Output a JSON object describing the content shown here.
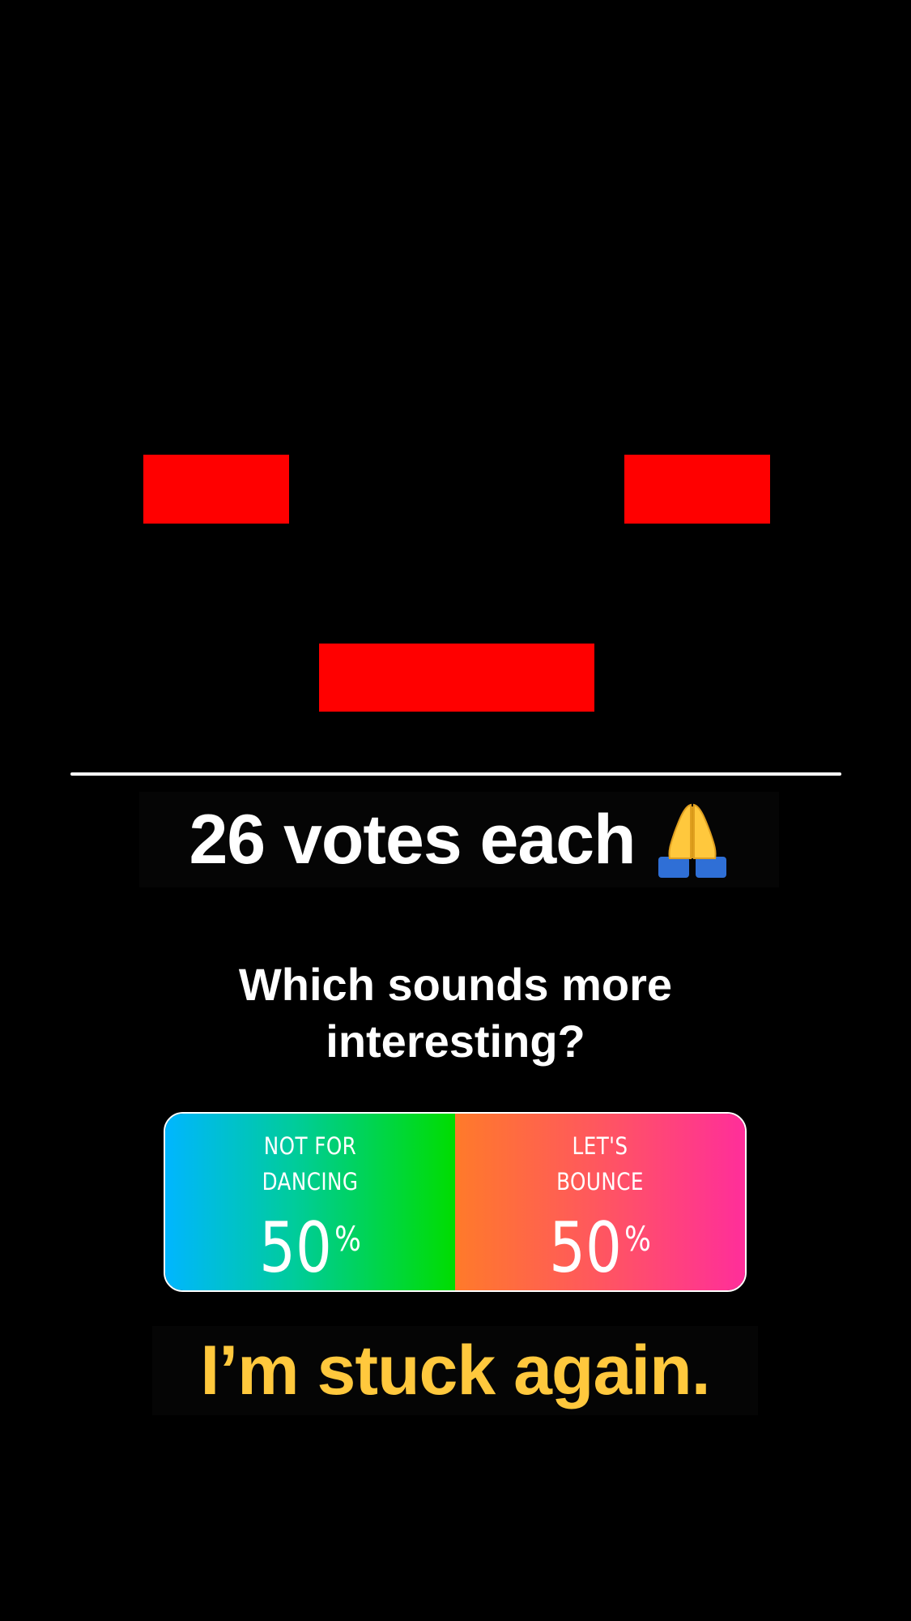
{
  "colors": {
    "background": "#000000",
    "redaction": "#ff0000",
    "caption_text": "#ffffff",
    "bottom_caption_text": "#ffc83d",
    "poll_left_gradient": [
      "#00b6ff",
      "#00dd00"
    ],
    "poll_right_gradient": [
      "#ff7a2a",
      "#ff2e9a"
    ]
  },
  "top_caption": {
    "text": "26 votes each",
    "icon": "folded-hands-icon"
  },
  "poll": {
    "question": "Which sounds more interesting?",
    "options": [
      {
        "label_line1": "NOT FOR",
        "label_line2": "DANCING",
        "percent": "50",
        "percent_sign": "%"
      },
      {
        "label_line1": "LET'S",
        "label_line2": "BOUNCE",
        "percent": "50",
        "percent_sign": "%"
      }
    ]
  },
  "bottom_caption": {
    "text": "I’m stuck again."
  }
}
